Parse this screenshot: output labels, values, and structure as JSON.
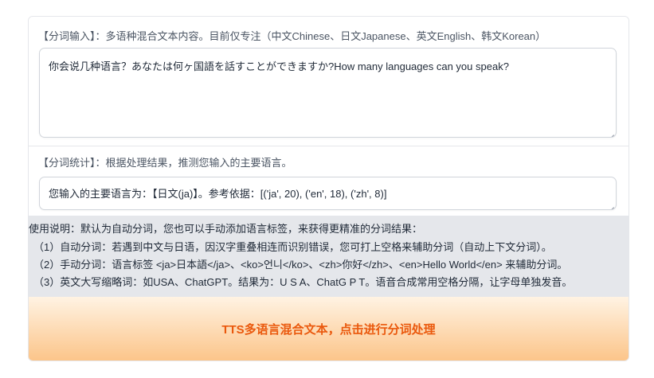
{
  "input_block": {
    "label": "【分词输入】：多语种混合文本内容。目前仅专注（中文Chinese、日文Japanese、英文English、韩文Korean）",
    "value": "你会说几种语言？あなたは何ヶ国語を話すことができますか?How many languages can you speak?"
  },
  "stats_block": {
    "label": "【分词统计】：根据处理结果，推测您输入的主要语言。",
    "value": "您输入的主要语言为：【日文(ja)】。参考依据：[('ja', 20), ('en', 18), ('zh', 8)]"
  },
  "instructions": {
    "title": "使用说明：默认为自动分词，您也可以手动添加语言标签，来获得更精准的分词结果：",
    "items": [
      "（1）自动分词：若遇到中文与日语，因汉字重叠相连而识别错误，您可打上空格来辅助分词（自动上下文分词）。",
      "（2）手动分词：语言标签 <ja>日本語</ja>、<ko>언니</ko>、<zh>你好</zh>、<en>Hello World</en> 来辅助分词。",
      "（3）英文大写缩略词：如USA、ChatGPT。结果为：U S A、ChatG P T。语音合成常用空格分隔，让字母单独发音。"
    ]
  },
  "run_button": {
    "label": "TTS多语言混合文本，点击进行分词处理"
  }
}
